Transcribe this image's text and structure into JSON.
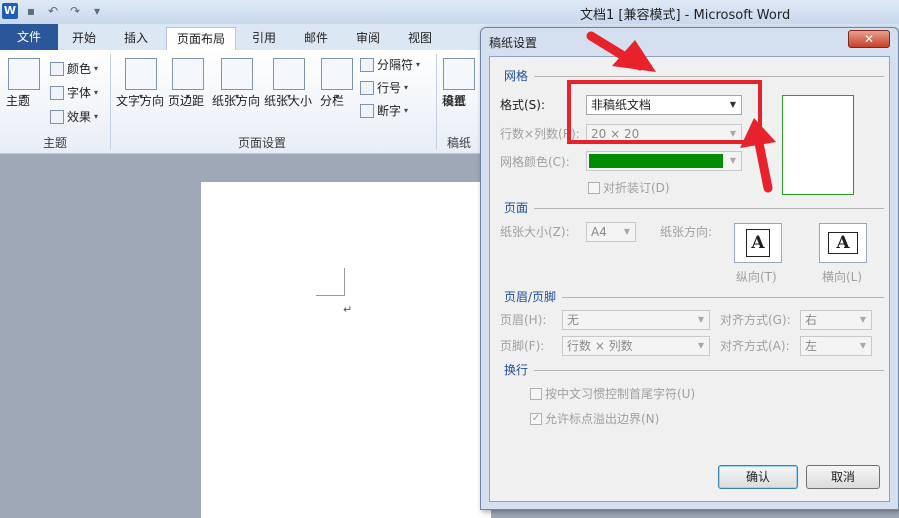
{
  "window": {
    "title": "文档1 [兼容模式] - Microsoft Word"
  },
  "qat": {
    "word_icon": "W",
    "save_icon": "save-icon",
    "undo_icon": "undo-icon",
    "redo_icon": "redo-icon"
  },
  "tabs": [
    {
      "label": "文件"
    },
    {
      "label": "开始"
    },
    {
      "label": "插入"
    },
    {
      "label": "页面布局"
    },
    {
      "label": "引用"
    },
    {
      "label": "邮件"
    },
    {
      "label": "审阅"
    },
    {
      "label": "视图"
    }
  ],
  "ribbon": {
    "theme_group": {
      "label": "主题",
      "theme": "主题",
      "colors": "颜色",
      "fonts": "字体",
      "effects": "效果"
    },
    "page_setup_group": {
      "label": "页面设置",
      "text_direction": "文字方向",
      "margins": "页边距",
      "orientation": "纸张方向",
      "size": "纸张大小",
      "columns": "分栏",
      "breaks": "分隔符",
      "line_numbers": "行号",
      "hyphenation": "断字"
    },
    "manuscript_group": {
      "label": "稿纸",
      "button": "稿纸",
      "button2": "设置"
    }
  },
  "document": {
    "para_mark": "↵"
  },
  "dialog": {
    "title": "稿纸设置",
    "close": "✕",
    "grid": {
      "section": "网格",
      "format_label": "格式(S):",
      "format_value": "非稿纸文档",
      "rows_cols_label": "行数×列数(R):",
      "rows_cols_value": "20 × 20",
      "grid_color_label": "网格颜色(C):",
      "grid_color": "#008c00",
      "fold_binding": "对折装订(D)"
    },
    "page": {
      "section": "页面",
      "paper_size_label": "纸张大小(Z):",
      "paper_size_value": "A4",
      "orientation_label": "纸张方向:",
      "portrait": "纵向(T)",
      "landscape": "横向(L)",
      "orient_glyph": "A"
    },
    "header_footer": {
      "section": "页眉/页脚",
      "header_label": "页眉(H):",
      "header_value": "无",
      "header_align_label": "对齐方式(G):",
      "header_align_value": "右",
      "footer_label": "页脚(F):",
      "footer_value": "行数 × 列数",
      "footer_align_label": "对齐方式(A):",
      "footer_align_value": "左"
    },
    "line_break": {
      "section": "换行",
      "opt1": "按中文习惯控制首尾字符(U)",
      "opt2": "允许标点溢出边界(N)"
    },
    "ok": "确认",
    "cancel": "取消"
  },
  "colors": {
    "accent": "#2b579a",
    "annotation": "#e8222a",
    "preview_border": "#2a9a2a"
  }
}
